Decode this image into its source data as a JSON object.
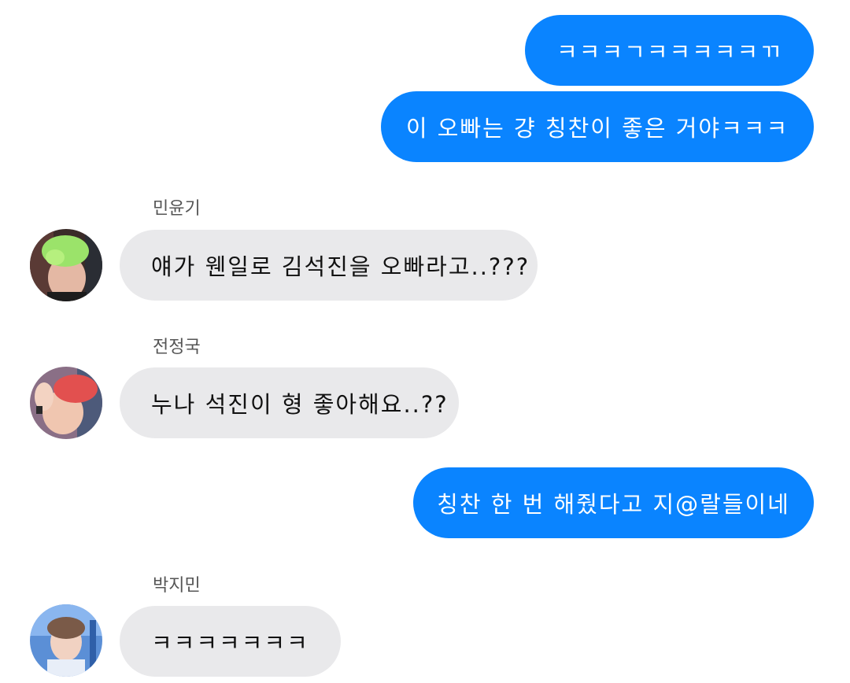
{
  "messages": {
    "m1": {
      "text": "ㅋㅋㅋㄱㅋㅋㅋㅋㅋㄲ"
    },
    "m2": {
      "text": "이 오빠는 걍 칭찬이 좋은 거야ㅋㅋㅋ"
    },
    "m3": {
      "sender": "민윤기",
      "text": "얘가 웬일로 김석진을 오빠라고..???"
    },
    "m4": {
      "sender": "전정국",
      "text": "누나 석진이 형 좋아해요..??"
    },
    "m5": {
      "text": "칭찬 한 번 해줬다고 지@랄들이네"
    },
    "m6": {
      "sender": "박지민",
      "text": "ㅋㅋㅋㅋㅋㅋㅋ"
    }
  },
  "colors": {
    "outgoing_bubble": "#0a84ff",
    "incoming_bubble": "#e9e9eb",
    "sender_name": "#555555"
  },
  "avatars": {
    "yoongi": "avatar-green-hair",
    "jungkook": "avatar-red-hair",
    "jimin": "avatar-blue-background"
  }
}
